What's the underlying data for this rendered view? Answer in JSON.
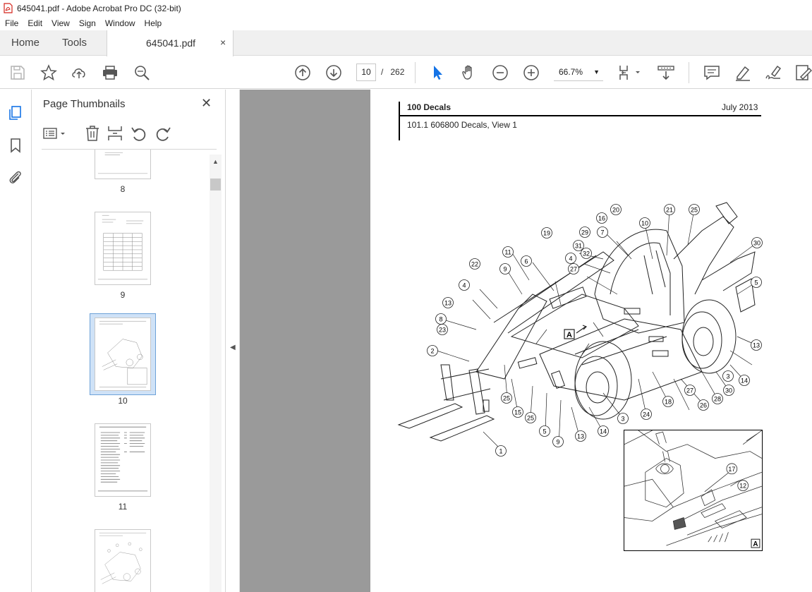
{
  "window": {
    "title": "645041.pdf - Adobe Acrobat Pro DC (32-bit)"
  },
  "menu": [
    "File",
    "Edit",
    "View",
    "Sign",
    "Window",
    "Help"
  ],
  "tabs": {
    "home": "Home",
    "tools": "Tools",
    "document": "645041.pdf",
    "close": "×"
  },
  "toolbar": {
    "current_page": "10",
    "page_separator": "/",
    "total_pages": "262",
    "zoom": "66.7%"
  },
  "panel": {
    "title": "Page Thumbnails",
    "close": "✕",
    "thumbnails": [
      {
        "label": "8"
      },
      {
        "label": "9"
      },
      {
        "label": "10",
        "selected": true
      },
      {
        "label": "11"
      },
      {
        "label": ""
      }
    ]
  },
  "document": {
    "header_left": "100 Decals",
    "header_right": "July 2013",
    "subheader": "101.1 606800 Decals, View 1",
    "callouts": [
      "1",
      "2",
      "3",
      "3",
      "4",
      "4",
      "5",
      "5",
      "6",
      "7",
      "8",
      "9",
      "9",
      "10",
      "11",
      "12",
      "13",
      "13",
      "13",
      "14",
      "14",
      "15",
      "16",
      "17",
      "18",
      "19",
      "20",
      "21",
      "22",
      "23",
      "24",
      "25",
      "25",
      "25",
      "26",
      "27",
      "27",
      "28",
      "29",
      "30",
      "30",
      "31",
      "32"
    ],
    "view_marker": "A"
  },
  "colors": {
    "accent_blue": "#1473e6",
    "viewer_bg": "#9a9a9a",
    "selected_thumb": "#cfe2f7"
  }
}
